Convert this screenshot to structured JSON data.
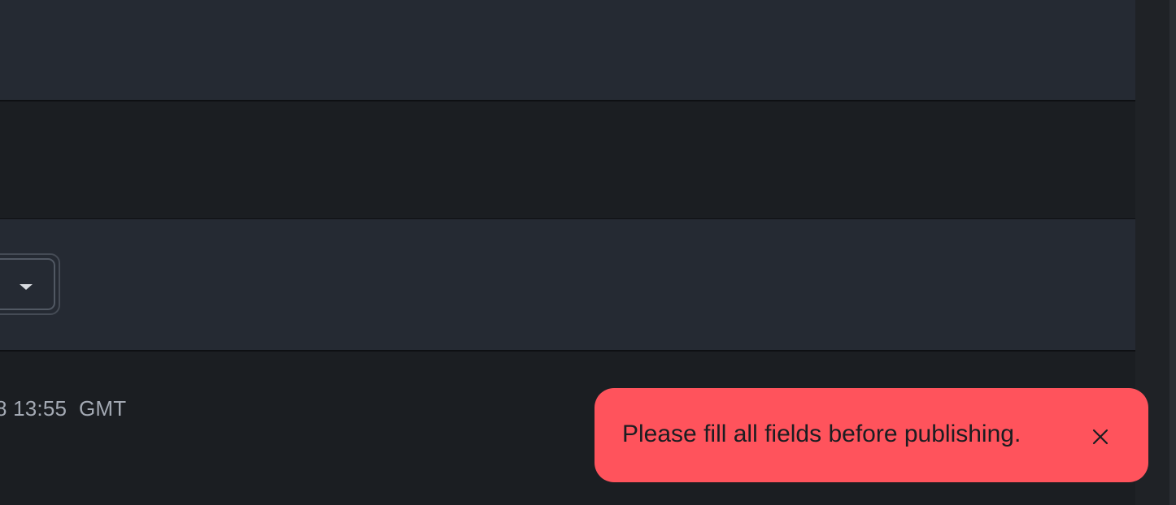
{
  "form": {
    "select": {
      "icon": "caret-down-icon"
    },
    "timestamp": "8 13:55  GMT"
  },
  "toast": {
    "message": "Please fill all fields before publishing.",
    "close_icon": "close-icon",
    "background_color": "#ff535c"
  },
  "theme": {
    "page_background": "#1b1e22",
    "panel_background": "#252a33"
  }
}
